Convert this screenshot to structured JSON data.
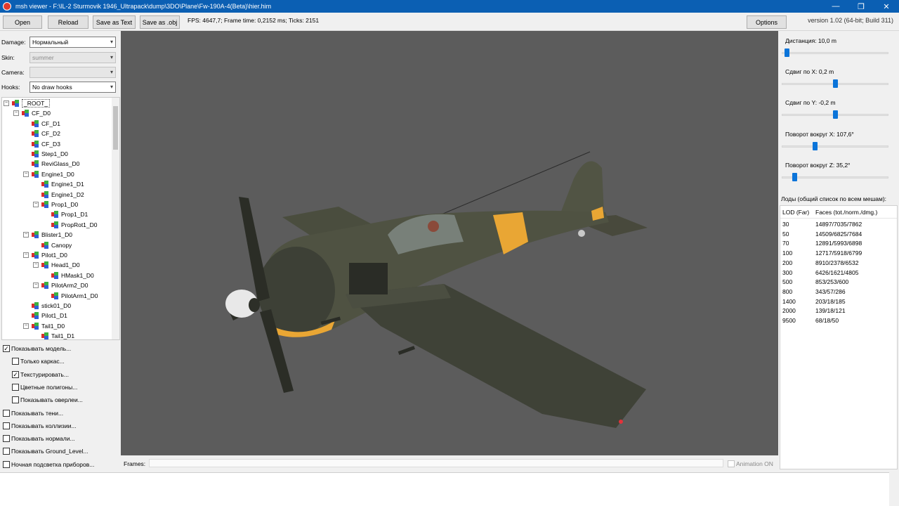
{
  "window": {
    "title": "msh viewer - F:\\IL-2 Sturmovik 1946_Ultrapack\\dump\\3DO\\Plane\\Fw-190A-4(Beta)\\hier.him",
    "minimize": "—",
    "maximize": "❐",
    "close": "✕"
  },
  "toolbar": {
    "open": "Open",
    "reload": "Reload",
    "save_text": "Save as Text",
    "save_obj": "Save as .obj",
    "status": "FPS: 4647,7; Frame time: 0,2152 ms; Ticks: 2151",
    "options": "Options",
    "version": "version 1.02 (64-bit; Build 311)"
  },
  "left": {
    "damage_label": "Damage:",
    "damage_value": "Нормальный",
    "skin_label": "Skin:",
    "skin_value": "summer",
    "camera_label": "Camera:",
    "camera_value": "",
    "hooks_label": "Hooks:",
    "hooks_value": "No draw hooks",
    "tree": [
      {
        "label": "_ROOT_",
        "depth": 0,
        "expander": "⊟",
        "root": true
      },
      {
        "label": "CF_D0",
        "depth": 1,
        "expander": "⊟"
      },
      {
        "label": "CF_D1",
        "depth": 2
      },
      {
        "label": "CF_D2",
        "depth": 2
      },
      {
        "label": "CF_D3",
        "depth": 2
      },
      {
        "label": "Step1_D0",
        "depth": 2
      },
      {
        "label": "ReviGlass_D0",
        "depth": 2
      },
      {
        "label": "Engine1_D0",
        "depth": 2,
        "expander": "⊟"
      },
      {
        "label": "Engine1_D1",
        "depth": 3
      },
      {
        "label": "Engine1_D2",
        "depth": 3
      },
      {
        "label": "Prop1_D0",
        "depth": 3,
        "expander": "⊟"
      },
      {
        "label": "Prop1_D1",
        "depth": 4
      },
      {
        "label": "PropRot1_D0",
        "depth": 4
      },
      {
        "label": "Blister1_D0",
        "depth": 2,
        "expander": "⊟"
      },
      {
        "label": "Canopy",
        "depth": 3
      },
      {
        "label": "Pilot1_D0",
        "depth": 2,
        "expander": "⊟"
      },
      {
        "label": "Head1_D0",
        "depth": 3,
        "expander": "⊟"
      },
      {
        "label": "HMask1_D0",
        "depth": 4
      },
      {
        "label": "PilotArm2_D0",
        "depth": 3,
        "expander": "⊟"
      },
      {
        "label": "PilotArm1_D0",
        "depth": 4
      },
      {
        "label": "stick01_D0",
        "depth": 2
      },
      {
        "label": "Pilot1_D1",
        "depth": 2
      },
      {
        "label": "Tail1_D0",
        "depth": 2,
        "expander": "⊟"
      },
      {
        "label": "Tail1_D1",
        "depth": 3
      }
    ],
    "checks": [
      {
        "label": "Показывать модель...",
        "checked": true,
        "indent": 0
      },
      {
        "label": "Только каркас...",
        "checked": false,
        "indent": 1
      },
      {
        "label": "Текстурировать...",
        "checked": true,
        "indent": 1
      },
      {
        "label": "Цветные полигоны...",
        "checked": false,
        "indent": 1
      },
      {
        "label": "Показывать оверлеи...",
        "checked": false,
        "indent": 1
      },
      {
        "label": "Показывать тени...",
        "checked": false,
        "indent": 0
      },
      {
        "label": "Показывать коллизии...",
        "checked": false,
        "indent": 0
      },
      {
        "label": "Показывать нормали...",
        "checked": false,
        "indent": 0
      },
      {
        "label": "Показывать Ground_Level...",
        "checked": false,
        "indent": 0
      },
      {
        "label": "Ночная подсветка приборов...",
        "checked": false,
        "indent": 0
      }
    ]
  },
  "frames": {
    "label": "Frames:",
    "animation": "Animation ON"
  },
  "right": {
    "params": [
      {
        "label": "Дистанция:  10,0 m",
        "level": 0.03
      },
      {
        "label": "Сдвиг по X:  0,2 m",
        "level": 0.5
      },
      {
        "label": "Сдвиг по Y:  -0,2 m",
        "level": 0.5
      },
      {
        "label": "Поворот вокруг X:  107,6°",
        "level": 0.3
      },
      {
        "label": "Поворот вокруг Z:  35,2°",
        "level": 0.1
      }
    ],
    "lods_title": "Лоды (общий список по всем мешам):",
    "lods_col1": "LOD (Far)",
    "lods_col2": "Faces (tot./norm./dmg.)",
    "lods": [
      {
        "lod": "30",
        "faces": "14897/7035/7862"
      },
      {
        "lod": "50",
        "faces": "14509/6825/7684"
      },
      {
        "lod": "70",
        "faces": "12891/5993/6898"
      },
      {
        "lod": "100",
        "faces": "12717/5918/6799"
      },
      {
        "lod": "200",
        "faces": "8910/2378/6532"
      },
      {
        "lod": "300",
        "faces": "6426/1621/4805"
      },
      {
        "lod": "500",
        "faces": "853/253/600"
      },
      {
        "lod": "800",
        "faces": "343/57/286"
      },
      {
        "lod": "1400",
        "faces": "203/18/185"
      },
      {
        "lod": "2000",
        "faces": "139/18/121"
      },
      {
        "lod": "9500",
        "faces": "68/18/50"
      }
    ]
  },
  "colors": {
    "titlebar": "#0b5fb3",
    "viewport": "#5c5c5c",
    "slider_knob": "#0b74d9",
    "camo_yellow": "#e9a634"
  }
}
